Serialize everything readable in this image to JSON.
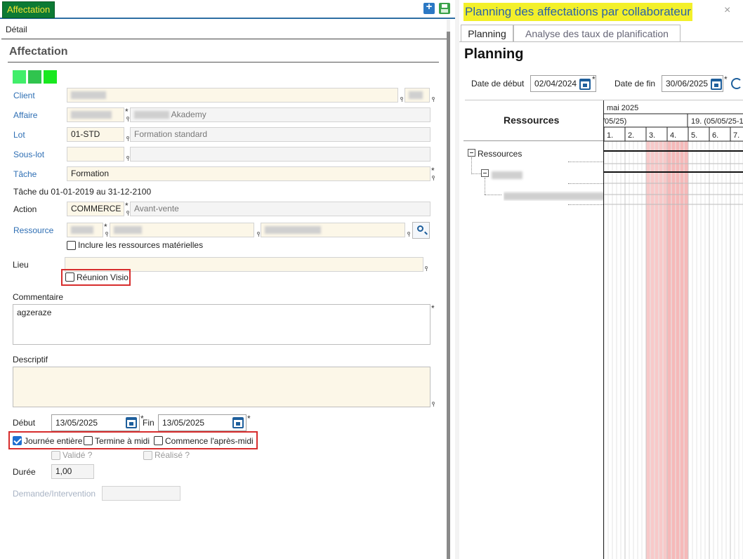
{
  "left": {
    "tab_label": "Affectation",
    "tab_bar_label": "Détail",
    "section_title": "Affectation",
    "swatch_colors": [
      "#41ee6a",
      "#30c44e",
      "#18e81f"
    ],
    "fields": {
      "client": {
        "label": "Client"
      },
      "affaire": {
        "label": "Affaire",
        "description": "Akademy"
      },
      "lot": {
        "label": "Lot",
        "code": "01-STD",
        "description": "Formation standard"
      },
      "sous_lot": {
        "label": "Sous-lot"
      },
      "tache": {
        "label": "Tâche",
        "value": "Formation",
        "period": "Tâche du 01-01-2019 au 31-12-2100"
      },
      "action": {
        "label": "Action",
        "code": "COMMERCE",
        "description": "Avant-vente"
      },
      "ressource": {
        "label": "Ressource",
        "include_material_label": "Inclure les ressources matérielles",
        "include_material_checked": false
      },
      "lieu": {
        "label": "Lieu",
        "visio_label": "Réunion Visio",
        "visio_checked": false
      },
      "commentaire": {
        "label": "Commentaire",
        "value": "agzeraze"
      },
      "descriptif": {
        "label": "Descriptif"
      },
      "debut": {
        "label": "Début",
        "value": "13/05/2025"
      },
      "fin": {
        "label": "Fin",
        "value": "13/05/2025"
      },
      "journee_entiere": {
        "label": "Journée entière",
        "checked": true
      },
      "termine_midi": {
        "label": "Termine à midi",
        "checked": false
      },
      "commence_apres_midi": {
        "label": "Commence l'après-midi",
        "checked": false
      },
      "valide": {
        "label": "Validé ?",
        "checked": false
      },
      "realise": {
        "label": "Réalisé ?",
        "checked": false
      },
      "duree": {
        "label": "Durée",
        "value": "1,00"
      },
      "demande": {
        "label": "Demande/Intervention"
      }
    },
    "required_mark": "*"
  },
  "right": {
    "window_title": "Planning des affectations par collaborateur",
    "close_glyph": "×",
    "tabs": [
      {
        "label": "Planning",
        "active": true
      },
      {
        "label": "Analyse des taux de planification",
        "active": false
      }
    ],
    "heading": "Planning",
    "date_debut": {
      "label": "Date de début",
      "value": "02/04/2024"
    },
    "date_fin": {
      "label": "Date de fin",
      "value": "30/06/2025"
    },
    "resources_header": "Ressources",
    "tree_root_label": "Ressources",
    "gantt": {
      "month_label": "mai 2025",
      "week_labels": [
        "/05/25)",
        "19. (05/05/25-1"
      ],
      "day_labels": [
        "1.",
        "2.",
        "3.",
        "4.",
        "5.",
        "6.",
        "7."
      ],
      "highlight_color": "#f8c9c9"
    }
  }
}
